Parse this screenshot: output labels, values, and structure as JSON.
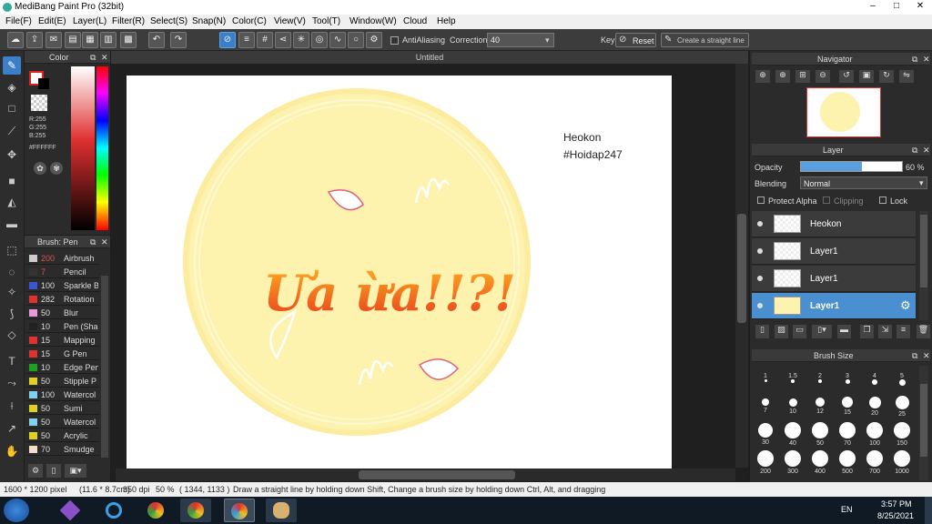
{
  "app": {
    "title": "MediBang Paint Pro (32bit)"
  },
  "window_controls": [
    "–",
    "□",
    "✕"
  ],
  "menu": [
    "File(F)",
    "Edit(E)",
    "Layer(L)",
    "Filter(R)",
    "Select(S)",
    "Snap(N)",
    "Color(C)",
    "View(V)",
    "Tool(T)",
    "Window(W)",
    "Cloud",
    "Help"
  ],
  "toolbar": {
    "antialiasing_label": "AntiAliasing",
    "correction_label": "Correction",
    "correction_value": "40",
    "key_label": "Key",
    "reset_label": "Reset",
    "straight_line_label": "Create a straight line"
  },
  "color_panel": {
    "title": "Color",
    "r": "R:255",
    "g": "G:255",
    "b": "B:255",
    "hex": "#FFFFFF"
  },
  "brush_panel": {
    "title": "Brush: Pen",
    "items": [
      {
        "size": "200",
        "name": "Airbrush",
        "color": "#cccccc",
        "size_color": "#e05050"
      },
      {
        "size": "7",
        "name": "Pencil",
        "color": "#333333",
        "size_color": "#e05050"
      },
      {
        "size": "100",
        "name": "Sparkle B",
        "color": "#3a55d0",
        "size_color": "#dddddd"
      },
      {
        "size": "282",
        "name": "Rotation",
        "color": "#e03030",
        "size_color": "#dddddd"
      },
      {
        "size": "50",
        "name": "Blur",
        "color": "#e89ad8",
        "size_color": "#dddddd"
      },
      {
        "size": "10",
        "name": "Pen (Sha",
        "color": "#222222",
        "size_color": "#dddddd"
      },
      {
        "size": "15",
        "name": "Mapping",
        "color": "#e03030",
        "size_color": "#dddddd"
      },
      {
        "size": "15",
        "name": "G Pen",
        "color": "#e03030",
        "size_color": "#dddddd"
      },
      {
        "size": "10",
        "name": "Edge Pen",
        "color": "#20a020",
        "size_color": "#dddddd"
      },
      {
        "size": "50",
        "name": "Stipple P",
        "color": "#e0d020",
        "size_color": "#dddddd"
      },
      {
        "size": "100",
        "name": "Watercol",
        "color": "#80d0f0",
        "size_color": "#dddddd"
      },
      {
        "size": "50",
        "name": "Sumi",
        "color": "#e0d020",
        "size_color": "#dddddd"
      },
      {
        "size": "50",
        "name": "Watercol",
        "color": "#80d0f0",
        "size_color": "#dddddd"
      },
      {
        "size": "50",
        "name": "Acrylic",
        "color": "#e0d020",
        "size_color": "#dddddd"
      },
      {
        "size": "70",
        "name": "Smudge",
        "color": "#f5dcc8",
        "size_color": "#dddddd"
      }
    ]
  },
  "document": {
    "tab_title": "Untitled",
    "credit_line1": "Heokon",
    "credit_line2": "#Hoidap247",
    "artwork_text": "Ưa  ừa!!?!"
  },
  "navigator": {
    "title": "Navigator"
  },
  "layer_panel": {
    "title": "Layer",
    "opacity_label": "Opacity",
    "opacity_value": "60 %",
    "opacity_fraction": 0.6,
    "blending_label": "Blending",
    "blending_value": "Normal",
    "protect_alpha": "Protect Alpha",
    "clipping": "Clipping",
    "lock": "Lock",
    "layers": [
      "Heokon",
      "Layer1",
      "Layer1",
      "Layer1"
    ]
  },
  "brush_size": {
    "title": "Brush Size",
    "sizes": [
      "1",
      "1.5",
      "2",
      "3",
      "4",
      "5",
      "7",
      "10",
      "12",
      "15",
      "20",
      "25",
      "30",
      "40",
      "50",
      "70",
      "100",
      "150",
      "200",
      "300",
      "400",
      "500",
      "700",
      "1000"
    ]
  },
  "status": {
    "size": "1600 * 1200 pixel",
    "cm": "(11.6 * 8.7cm)",
    "dpi": "350 dpi",
    "zoom": "50 %",
    "coords": "( 1344, 1133 )",
    "hint": "Draw a straight line by holding down Shift, Change a brush size by holding down Ctrl, Alt, and dragging"
  },
  "taskbar": {
    "lang": "EN",
    "time": "3:57 PM",
    "date": "8/25/2021"
  }
}
